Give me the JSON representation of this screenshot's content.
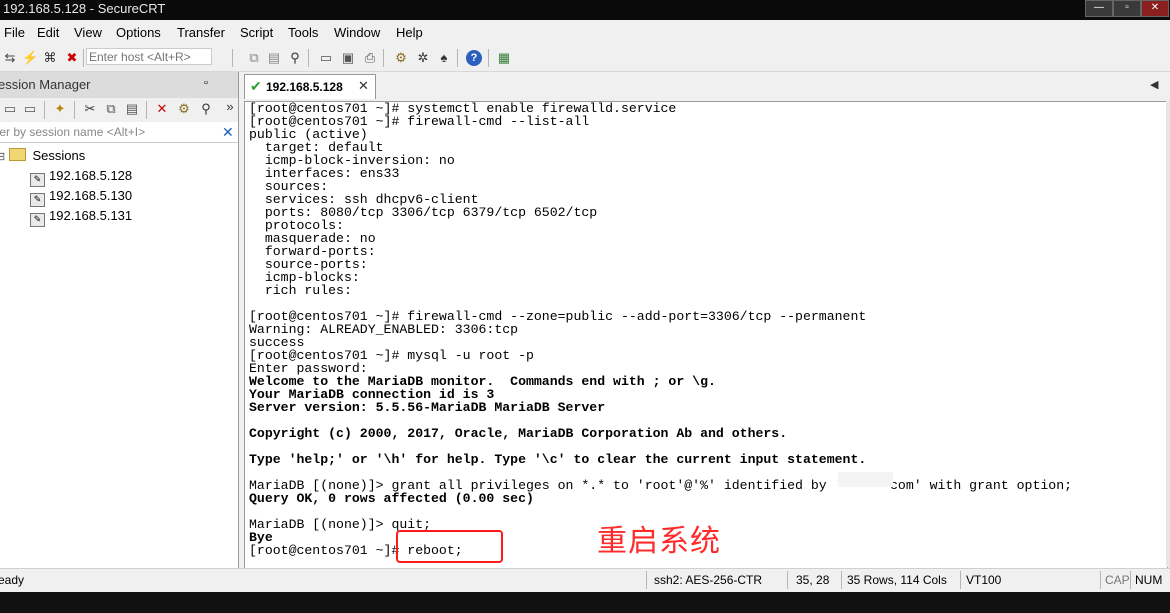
{
  "window": {
    "title": "192.168.5.128 - SecureCRT",
    "controls": [
      "—",
      "▫",
      "✕"
    ]
  },
  "menu": [
    "File",
    "Edit",
    "View",
    "Options",
    "Transfer",
    "Script",
    "Tools",
    "Window",
    "Help"
  ],
  "toolbar": {
    "host_placeholder": "Enter host <Alt+R>"
  },
  "session_manager": {
    "title": "ession Manager",
    "pin": "▫",
    "more": "»",
    "filter_placeholder": "ter by session name <Alt+I>",
    "filter_clear": "✕",
    "root": {
      "toggle": "⊟",
      "label": "Sessions"
    },
    "sessions": [
      "192.168.5.128",
      "192.168.5.130",
      "192.168.5.131"
    ]
  },
  "tabs": [
    {
      "label": "192.168.5.128",
      "status": "✔",
      "close": "✕"
    }
  ],
  "tab_nav": "◀",
  "terminal": {
    "lines": [
      {
        "text": "[root@centos701 ~]# systemctl enable firewalld.service",
        "bold": false
      },
      {
        "text": "[root@centos701 ~]# firewall-cmd --list-all",
        "bold": false
      },
      {
        "text": "public (active)",
        "bold": false
      },
      {
        "text": "  target: default",
        "bold": false
      },
      {
        "text": "  icmp-block-inversion: no",
        "bold": false
      },
      {
        "text": "  interfaces: ens33",
        "bold": false
      },
      {
        "text": "  sources:",
        "bold": false
      },
      {
        "text": "  services: ssh dhcpv6-client",
        "bold": false
      },
      {
        "text": "  ports: 8080/tcp 3306/tcp 6379/tcp 6502/tcp",
        "bold": false
      },
      {
        "text": "  protocols:",
        "bold": false
      },
      {
        "text": "  masquerade: no",
        "bold": false
      },
      {
        "text": "  forward-ports:",
        "bold": false
      },
      {
        "text": "  source-ports:",
        "bold": false
      },
      {
        "text": "  icmp-blocks:",
        "bold": false
      },
      {
        "text": "  rich rules:",
        "bold": false
      },
      {
        "text": "",
        "bold": false
      },
      {
        "text": "[root@centos701 ~]# firewall-cmd --zone=public --add-port=3306/tcp --permanent",
        "bold": false
      },
      {
        "text": "Warning: ALREADY_ENABLED: 3306:tcp",
        "bold": false
      },
      {
        "text": "success",
        "bold": false
      },
      {
        "text": "[root@centos701 ~]# mysql -u root -p",
        "bold": false
      },
      {
        "text": "Enter password:",
        "bold": false
      },
      {
        "text": "Welcome to the MariaDB monitor.  Commands end with ; or \\g.",
        "bold": true
      },
      {
        "text": "Your MariaDB connection id is 3",
        "bold": true
      },
      {
        "text": "Server version: 5.5.56-MariaDB MariaDB Server",
        "bold": true
      },
      {
        "text": "",
        "bold": false
      },
      {
        "text": "Copyright (c) 2000, 2017, Oracle, MariaDB Corporation Ab and others.",
        "bold": true
      },
      {
        "text": "",
        "bold": false
      },
      {
        "text": "Type 'help;' or '\\h' for help. Type '\\c' to clear the current input statement.",
        "bold": true
      },
      {
        "text": "",
        "bold": false
      },
      {
        "text": "MariaDB [(none)]> grant all privileges on *.* to 'root'@'%' identified by '      com' with grant option;",
        "bold": false
      },
      {
        "text": "Query OK, 0 rows affected (0.00 sec)",
        "bold": true
      },
      {
        "text": "",
        "bold": false
      },
      {
        "text": "MariaDB [(none)]> quit;",
        "bold": false
      },
      {
        "text": "Bye",
        "bold": true
      },
      {
        "text": "[root@centos701 ~]# reboot;",
        "bold": false
      }
    ]
  },
  "annotation": {
    "text": "重启系统",
    "color": "#ff2b2b"
  },
  "status": {
    "ready": "eady",
    "cipher": "ssh2: AES-256-CTR",
    "cursor": "35,  28",
    "size": "35 Rows, 114 Cols",
    "emulation": "VT100",
    "cap": "CAP",
    "num": "NUM"
  }
}
